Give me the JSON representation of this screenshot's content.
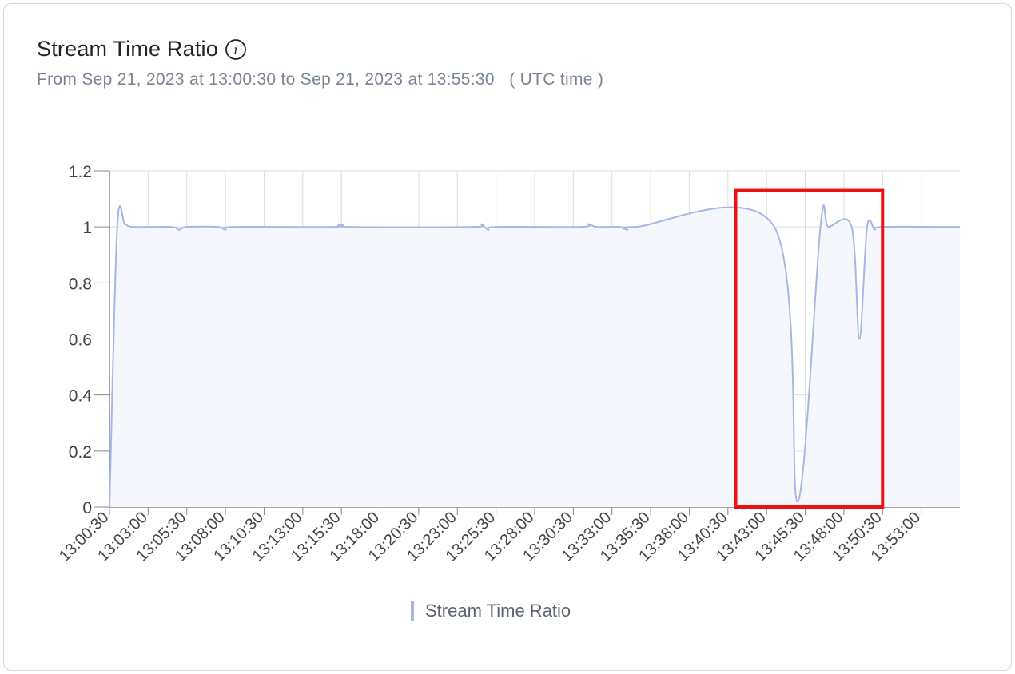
{
  "header": {
    "title": "Stream Time Ratio",
    "info_icon": "info-circle-icon",
    "subtitle": "From Sep 21, 2023 at 13:00:30 to Sep 21, 2023 at 13:55:30   ( UTC time )"
  },
  "colors": {
    "line": "#a8b6e6",
    "fill": "#f5f7fc",
    "grid": "#dddddd",
    "axis": "#888888",
    "highlight_box": "#ee1111"
  },
  "chart_data": {
    "type": "area",
    "title": "Stream Time Ratio",
    "xlabel": "",
    "ylabel": "",
    "x_ticks": [
      "13:00:30",
      "13:03:00",
      "13:05:30",
      "13:08:00",
      "13:10:30",
      "13:13:00",
      "13:15:30",
      "13:18:00",
      "13:20:30",
      "13:23:00",
      "13:25:30",
      "13:28:00",
      "13:30:30",
      "13:33:00",
      "13:35:30",
      "13:38:00",
      "13:40:30",
      "13:43:00",
      "13:45:30",
      "13:48:00",
      "13:50:30",
      "13:53:00"
    ],
    "x_range": [
      "13:00:30",
      "13:55:30"
    ],
    "y_ticks": [
      "0",
      "0.2",
      "0.4",
      "0.6",
      "0.8",
      "1",
      "1.2"
    ],
    "ylim": [
      0,
      1.2
    ],
    "grid": true,
    "legend_position": "bottom-center",
    "series": [
      {
        "name": "Stream Time Ratio",
        "points": [
          [
            "13:00:30",
            0
          ],
          [
            "13:01:00",
            1.0
          ],
          [
            "13:01:30",
            1.01
          ],
          [
            "13:02:00",
            1.0
          ],
          [
            "13:04:30",
            1.0
          ],
          [
            "13:05:00",
            0.99
          ],
          [
            "13:05:30",
            1.0
          ],
          [
            "13:07:30",
            1.0
          ],
          [
            "13:08:00",
            0.99
          ],
          [
            "13:08:30",
            1.0
          ],
          [
            "13:15:00",
            1.0
          ],
          [
            "13:15:30",
            1.01
          ],
          [
            "13:16:00",
            1.0
          ],
          [
            "13:24:00",
            1.0
          ],
          [
            "13:24:30",
            1.01
          ],
          [
            "13:25:00",
            0.99
          ],
          [
            "13:25:30",
            1.0
          ],
          [
            "13:31:00",
            1.0
          ],
          [
            "13:31:30",
            1.01
          ],
          [
            "13:32:00",
            1.0
          ],
          [
            "13:33:30",
            1.0
          ],
          [
            "13:34:00",
            0.99
          ],
          [
            "13:34:30",
            1.0
          ],
          [
            "13:43:30",
            1.0
          ],
          [
            "13:45:00",
            0.02
          ],
          [
            "13:46:30",
            1.01
          ],
          [
            "13:47:00",
            1.0
          ],
          [
            "13:48:30",
            1.0
          ],
          [
            "13:49:00",
            0.6
          ],
          [
            "13:49:30",
            1.0
          ],
          [
            "13:50:00",
            0.99
          ],
          [
            "13:50:30",
            1.0
          ],
          [
            "13:55:30",
            1.0
          ]
        ]
      }
    ],
    "annotations": [
      {
        "type": "highlight-box",
        "x_from": "13:41:00",
        "x_to": "13:50:30",
        "y_from": 0,
        "y_to": 1.13
      }
    ]
  },
  "legend": {
    "label": "Stream Time Ratio"
  }
}
